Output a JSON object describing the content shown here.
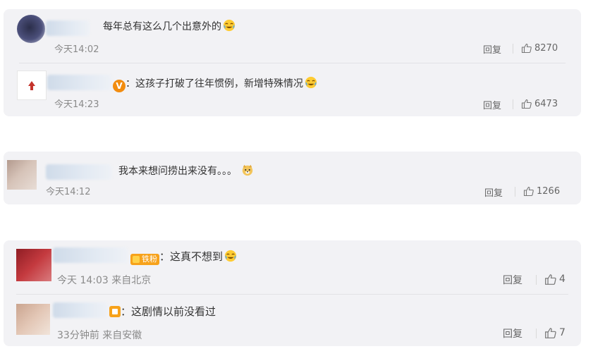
{
  "comments": [
    {
      "text": "每年总有这么几个出意外的",
      "time": "今天14:02",
      "reply_label": "回复",
      "likes": "8270",
      "reply": {
        "text": "：这孩子打破了往年惯例，新增特殊情况",
        "time": "今天14:23",
        "reply_label": "回复",
        "likes": "6473",
        "verified_badge": "V"
      }
    },
    {
      "text": "我本来想问捞出来没有。。。",
      "time": "今天14:12",
      "reply_label": "回复",
      "likes": "1266"
    },
    {
      "text": "：这真不想到",
      "time": "今天 14:03 来自北京",
      "reply_label": "回复",
      "likes": "4",
      "fan_badge": "铁粉",
      "reply": {
        "text": "：这剧情以前没看过",
        "time": "33分钟前 来自安徽",
        "reply_label": "回复",
        "likes": "7"
      }
    }
  ],
  "icons": {
    "like": "thumbs-up-icon",
    "emoji_laugh_cry": "laugh-cry-emoji-icon",
    "emoji_doge": "doge-emoji-icon"
  },
  "colors": {
    "card_bg": "#f2f2f5",
    "text": "#333333",
    "meta": "#8a8a8a",
    "badge_orange": "#f28c0f"
  }
}
